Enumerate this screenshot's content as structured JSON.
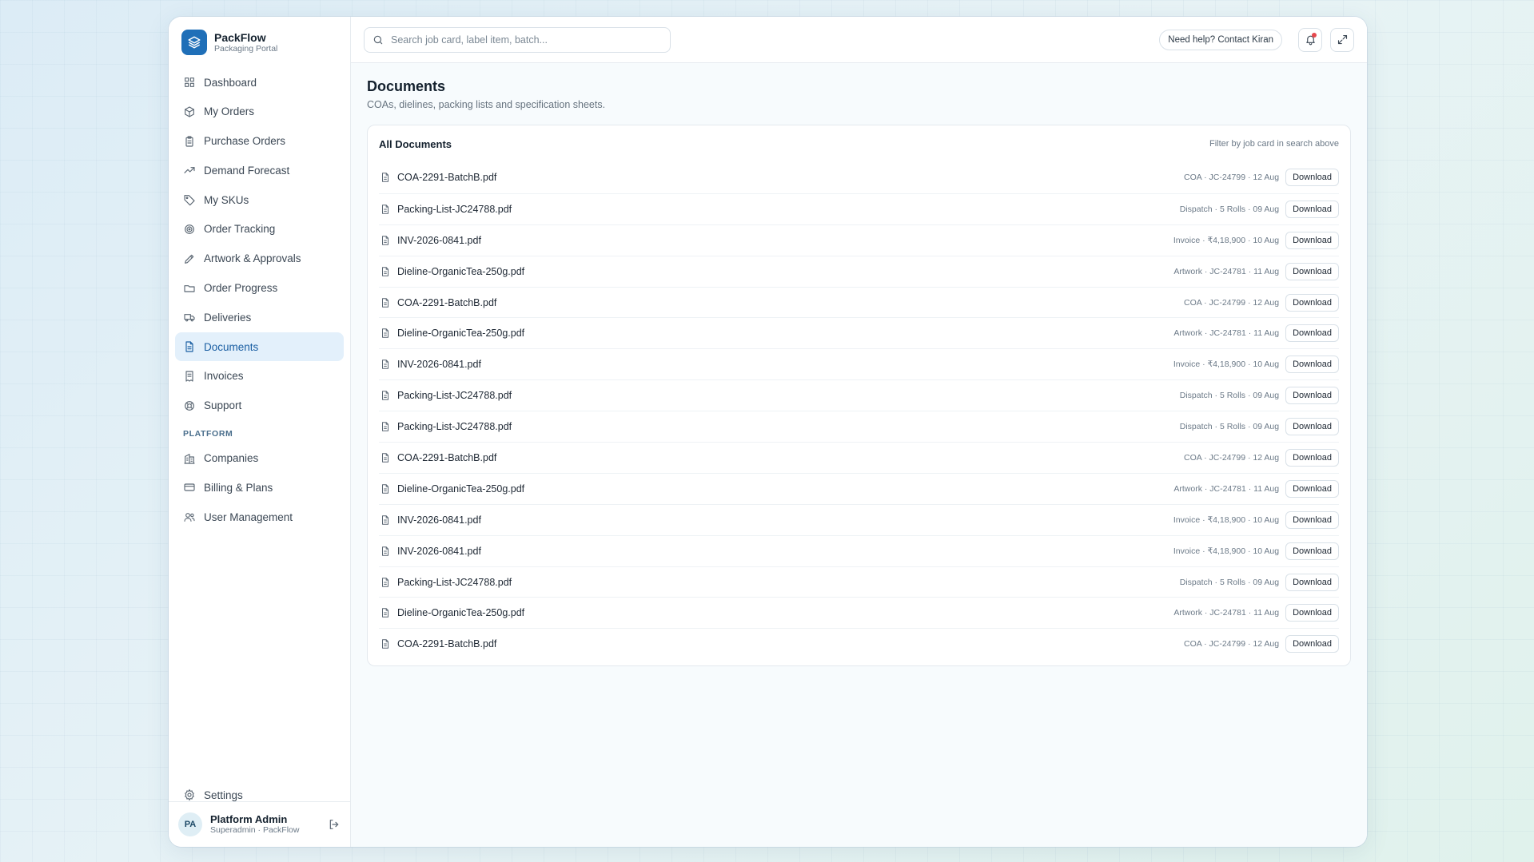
{
  "brand": {
    "name": "PackFlow",
    "subtitle": "Packaging Portal"
  },
  "sidebar": {
    "items": [
      {
        "label": "Dashboard",
        "icon": "dashboard-icon"
      },
      {
        "label": "My Orders",
        "icon": "box-icon"
      },
      {
        "label": "Purchase Orders",
        "icon": "clipboard-icon"
      },
      {
        "label": "Demand Forecast",
        "icon": "trending-up-icon"
      },
      {
        "label": "My SKUs",
        "icon": "tag-icon"
      },
      {
        "label": "Order Tracking",
        "icon": "target-icon"
      },
      {
        "label": "Artwork & Approvals",
        "icon": "pen-icon"
      },
      {
        "label": "Order Progress",
        "icon": "folder-icon"
      },
      {
        "label": "Deliveries",
        "icon": "truck-icon"
      },
      {
        "label": "Documents",
        "icon": "file-icon",
        "active": true
      },
      {
        "label": "Invoices",
        "icon": "receipt-icon"
      },
      {
        "label": "Support",
        "icon": "lifebuoy-icon"
      }
    ],
    "section_label": "PLATFORM",
    "platform_items": [
      {
        "label": "Companies",
        "icon": "building-icon"
      },
      {
        "label": "Billing & Plans",
        "icon": "credit-card-icon"
      },
      {
        "label": "User Management",
        "icon": "users-icon"
      }
    ],
    "settings_label": "Settings"
  },
  "user": {
    "initials": "PA",
    "name": "Platform Admin",
    "role": "Superadmin · PackFlow"
  },
  "topbar": {
    "search_placeholder": "Search job card, label item, batch...",
    "help_label": "Need help? Contact Kiran"
  },
  "page": {
    "title": "Documents",
    "subtitle": "COAs, dielines, packing lists and specification sheets."
  },
  "card": {
    "title": "All Documents",
    "hint": "Filter by job card in search above",
    "download_label": "Download",
    "rows": [
      {
        "name": "COA-2291-BatchB.pdf",
        "meta": "COA · JC-24799 · 12 Aug"
      },
      {
        "name": "Packing-List-JC24788.pdf",
        "meta": "Dispatch · 5 Rolls · 09 Aug"
      },
      {
        "name": "INV-2026-0841.pdf",
        "meta": "Invoice · ₹4,18,900 · 10 Aug"
      },
      {
        "name": "Dieline-OrganicTea-250g.pdf",
        "meta": "Artwork · JC-24781 · 11 Aug"
      },
      {
        "name": "COA-2291-BatchB.pdf",
        "meta": "COA · JC-24799 · 12 Aug"
      },
      {
        "name": "Dieline-OrganicTea-250g.pdf",
        "meta": "Artwork · JC-24781 · 11 Aug"
      },
      {
        "name": "INV-2026-0841.pdf",
        "meta": "Invoice · ₹4,18,900 · 10 Aug"
      },
      {
        "name": "Packing-List-JC24788.pdf",
        "meta": "Dispatch · 5 Rolls · 09 Aug"
      },
      {
        "name": "Packing-List-JC24788.pdf",
        "meta": "Dispatch · 5 Rolls · 09 Aug"
      },
      {
        "name": "COA-2291-BatchB.pdf",
        "meta": "COA · JC-24799 · 12 Aug"
      },
      {
        "name": "Dieline-OrganicTea-250g.pdf",
        "meta": "Artwork · JC-24781 · 11 Aug"
      },
      {
        "name": "INV-2026-0841.pdf",
        "meta": "Invoice · ₹4,18,900 · 10 Aug"
      },
      {
        "name": "INV-2026-0841.pdf",
        "meta": "Invoice · ₹4,18,900 · 10 Aug"
      },
      {
        "name": "Packing-List-JC24788.pdf",
        "meta": "Dispatch · 5 Rolls · 09 Aug"
      },
      {
        "name": "Dieline-OrganicTea-250g.pdf",
        "meta": "Artwork · JC-24781 · 11 Aug"
      },
      {
        "name": "COA-2291-BatchB.pdf",
        "meta": "COA · JC-24799 · 12 Aug"
      }
    ]
  },
  "colors": {
    "accent": "#1f6fb8",
    "active_bg": "#e3f0fb",
    "notification": "#e5484d"
  }
}
